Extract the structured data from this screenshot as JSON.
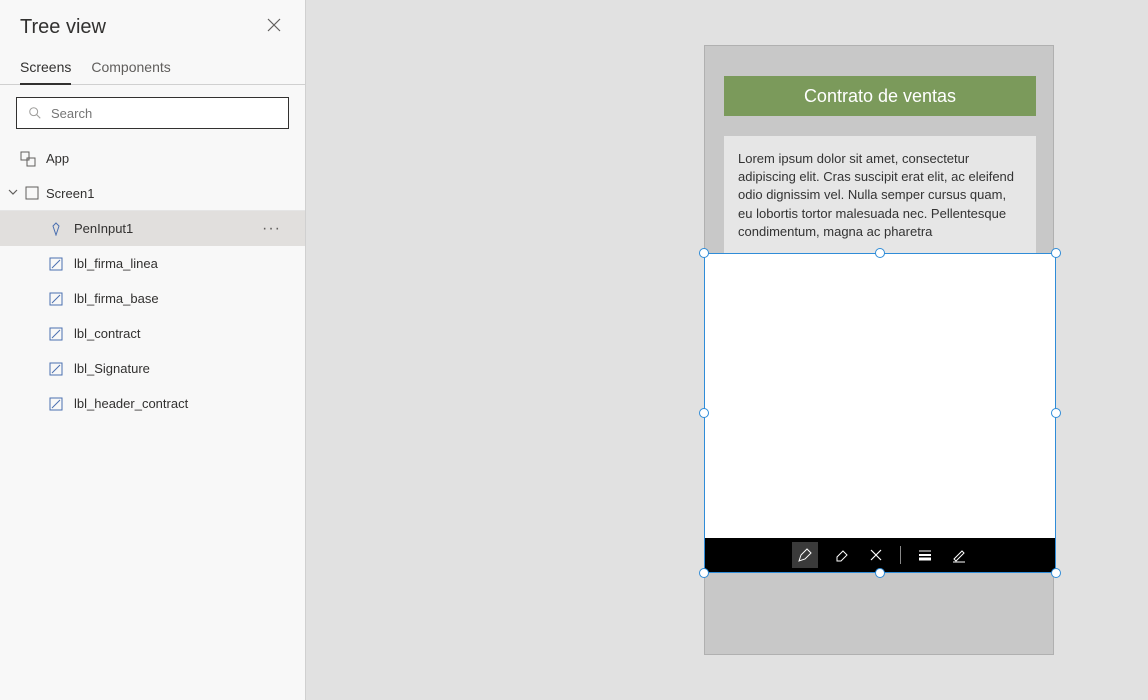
{
  "treeview": {
    "title": "Tree view",
    "tabs": {
      "screens": "Screens",
      "components": "Components"
    },
    "search_placeholder": "Search",
    "app_label": "App",
    "screen_label": "Screen1",
    "items": [
      {
        "label": "PenInput1"
      },
      {
        "label": "lbl_firma_linea"
      },
      {
        "label": "lbl_firma_base"
      },
      {
        "label": "lbl_contract"
      },
      {
        "label": "lbl_Signature"
      },
      {
        "label": "lbl_header_contract"
      }
    ]
  },
  "canvas": {
    "header_title": "Contrato de ventas",
    "body_text": "Lorem ipsum dolor sit amet, consectetur adipiscing elit. Cras suscipit erat elit, ac eleifend odio dignissim vel. Nulla semper cursus quam, eu lobortis tortor malesuada nec. Pellentesque condimentum, magna ac pharetra"
  }
}
